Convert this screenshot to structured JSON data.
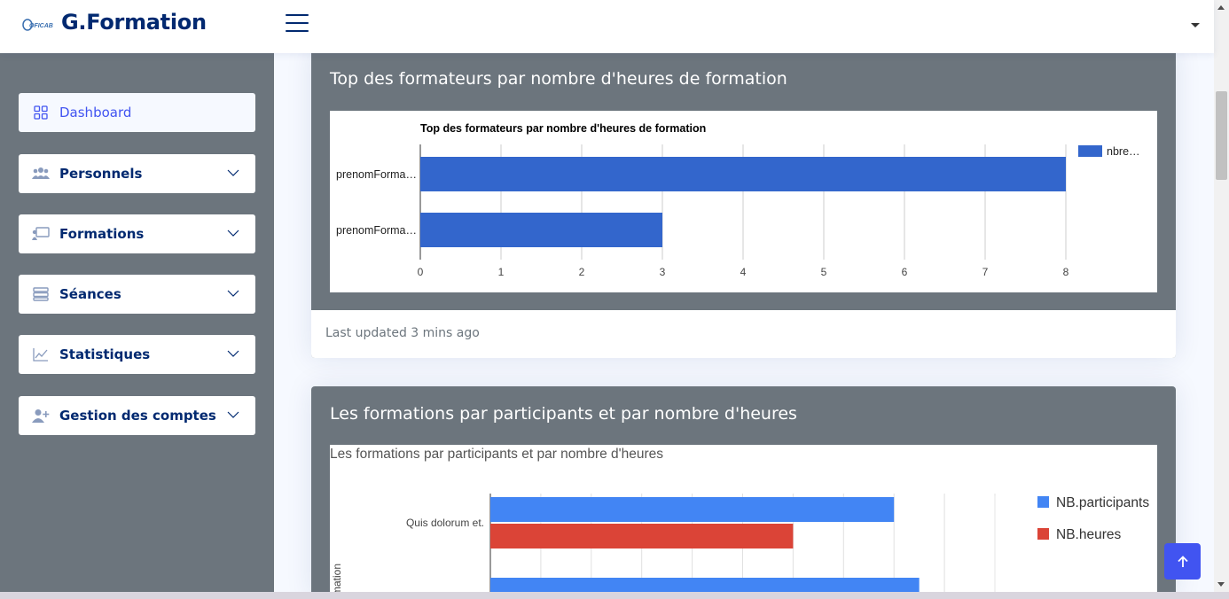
{
  "header": {
    "logo_text": "COFICAB",
    "brand": "G.Formation"
  },
  "sidebar": {
    "items": [
      {
        "label": "Dashboard",
        "icon": "grid-icon"
      },
      {
        "label": "Personnels",
        "icon": "people-icon"
      },
      {
        "label": "Formations",
        "icon": "presentation-icon"
      },
      {
        "label": "Séances",
        "icon": "list-icon"
      },
      {
        "label": "Statistiques",
        "icon": "line-chart-icon"
      },
      {
        "label": "Gestion des comptes",
        "icon": "person-add-icon"
      }
    ]
  },
  "card1": {
    "title": "Top des formateurs par nombre d'heures de formation",
    "footer": "Last updated 3 mins ago"
  },
  "card2": {
    "title": "Les formations par participants et par nombre d'heures"
  },
  "colors": {
    "accent": "#4154f1",
    "brand": "#012970",
    "bar_blue": "#3366cc",
    "series_blue": "#4285f4",
    "series_red": "#db4437"
  },
  "chart_data": [
    {
      "type": "bar",
      "orientation": "horizontal",
      "title": "Top des formateurs par nombre d'heures de formation",
      "categories": [
        "prenomForma…",
        "prenomForma…"
      ],
      "series": [
        {
          "name": "nbre…",
          "values": [
            8,
            3
          ]
        }
      ],
      "xticks": [
        "0",
        "1",
        "2",
        "3",
        "4",
        "5",
        "6",
        "7",
        "8"
      ],
      "xlim": [
        0,
        8
      ],
      "grid": true,
      "legend": "right"
    },
    {
      "type": "bar",
      "orientation": "horizontal",
      "title": "Les formations par participants et par nombre d'heures",
      "ylabel": "rmation",
      "categories": [
        "Quis dolorum et.",
        ""
      ],
      "series": [
        {
          "name": "NB.participants",
          "values": [
            8,
            8.5
          ]
        },
        {
          "name": "NB.heures",
          "values": [
            6,
            null
          ]
        }
      ],
      "xlim": [
        0,
        10
      ],
      "grid": true,
      "legend": "right"
    }
  ]
}
